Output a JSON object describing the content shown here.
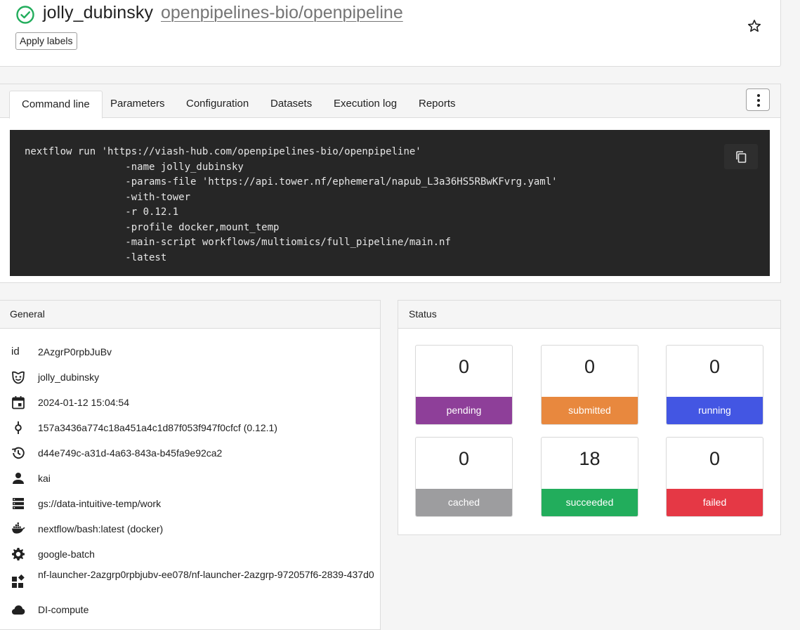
{
  "header": {
    "run_name": "jolly_dubinsky",
    "pipeline": "openpipelines-bio/openpipeline",
    "apply_labels": "Apply labels"
  },
  "tabs": [
    {
      "label": "Command line",
      "active": true
    },
    {
      "label": "Parameters",
      "active": false
    },
    {
      "label": "Configuration",
      "active": false
    },
    {
      "label": "Datasets",
      "active": false
    },
    {
      "label": "Execution log",
      "active": false
    },
    {
      "label": "Reports",
      "active": false
    }
  ],
  "command": {
    "lines": [
      "nextflow run 'https://viash-hub.com/openpipelines-bio/openpipeline'",
      "                 -name jolly_dubinsky",
      "                 -params-file 'https://api.tower.nf/ephemeral/napub_L3a36HS5RBwKFvrg.yaml'",
      "                 -with-tower",
      "                 -r 0.12.1",
      "                 -profile docker,mount_temp",
      "                 -main-script workflows/multiomics/full_pipeline/main.nf",
      "                 -latest"
    ]
  },
  "general": {
    "title": "General",
    "rows": [
      {
        "icon": "id-icon",
        "icon_text": "id",
        "value": "2AzgrP0rpbJuBv"
      },
      {
        "icon": "mask-icon",
        "value": "jolly_dubinsky"
      },
      {
        "icon": "calendar-icon",
        "value": "2024-01-12 15:04:54"
      },
      {
        "icon": "commit-icon",
        "value": "157a3436a774c18a451a4c1d87f053f947f0cfcf (0.12.1)"
      },
      {
        "icon": "history-icon",
        "value": "d44e749c-a31d-4a63-843a-b45fa9e92ca2"
      },
      {
        "icon": "user-icon",
        "value": "kai"
      },
      {
        "icon": "storage-icon",
        "value": "gs://data-intuitive-temp/work"
      },
      {
        "icon": "docker-icon",
        "value": "nextflow/bash:latest (docker)"
      },
      {
        "icon": "gear-icon",
        "value": "google-batch"
      },
      {
        "icon": "widgets-icon",
        "value": "nf-launcher-2azgrp0rpbjubv-ee078/nf-launcher-2azgrp-972057f6-2839-437d0"
      },
      {
        "icon": "cloud-icon",
        "value": "DI-compute"
      }
    ]
  },
  "status": {
    "title": "Status",
    "items": [
      {
        "label": "pending",
        "value": "0",
        "color": "#8e3f99"
      },
      {
        "label": "submitted",
        "value": "0",
        "color": "#e8883e"
      },
      {
        "label": "running",
        "value": "0",
        "color": "#4356e3"
      },
      {
        "label": "cached",
        "value": "0",
        "color": "#9d9d9f"
      },
      {
        "label": "succeeded",
        "value": "18",
        "color": "#22ad5c"
      },
      {
        "label": "failed",
        "value": "0",
        "color": "#e53845"
      }
    ]
  },
  "colors": {
    "success_green": "#22ad5c"
  }
}
